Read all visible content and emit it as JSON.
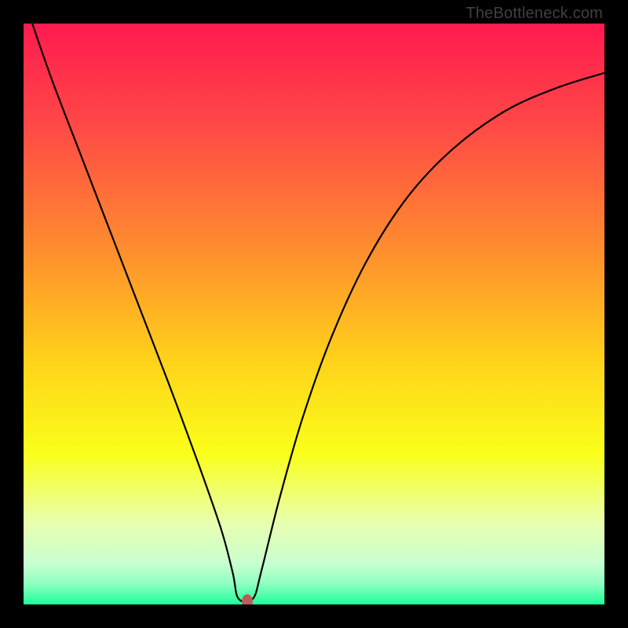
{
  "watermark": "TheBottleneck.com",
  "colors": {
    "frame": "#000000",
    "curve": "#000000",
    "marker": "#bb5d5d",
    "gradient_stops": [
      {
        "pos": 0.0,
        "color": "#ff1a4f"
      },
      {
        "pos": 0.18,
        "color": "#ff4a46"
      },
      {
        "pos": 0.38,
        "color": "#ff8a2f"
      },
      {
        "pos": 0.58,
        "color": "#ffd21a"
      },
      {
        "pos": 0.74,
        "color": "#faff1a"
      },
      {
        "pos": 0.86,
        "color": "#e8ffb0"
      },
      {
        "pos": 0.93,
        "color": "#c8ffd0"
      },
      {
        "pos": 0.965,
        "color": "#8cffc0"
      },
      {
        "pos": 1.0,
        "color": "#1dff9a"
      }
    ]
  },
  "chart_data": {
    "type": "line",
    "title": "",
    "xlabel": "",
    "ylabel": "",
    "xlim": [
      0,
      1
    ],
    "ylim": [
      0,
      1
    ],
    "annotations": [
      "TheBottleneck.com"
    ],
    "marker": {
      "x": 0.385,
      "y": 0.0
    },
    "series": [
      {
        "name": "bottleneck-curve",
        "points": [
          {
            "x": 0.015,
            "y": 1.0
          },
          {
            "x": 0.05,
            "y": 0.9
          },
          {
            "x": 0.1,
            "y": 0.77
          },
          {
            "x": 0.15,
            "y": 0.64
          },
          {
            "x": 0.2,
            "y": 0.51
          },
          {
            "x": 0.25,
            "y": 0.38
          },
          {
            "x": 0.3,
            "y": 0.245
          },
          {
            "x": 0.34,
            "y": 0.13
          },
          {
            "x": 0.36,
            "y": 0.055
          },
          {
            "x": 0.37,
            "y": 0.01
          },
          {
            "x": 0.395,
            "y": 0.01
          },
          {
            "x": 0.41,
            "y": 0.06
          },
          {
            "x": 0.44,
            "y": 0.18
          },
          {
            "x": 0.48,
            "y": 0.32
          },
          {
            "x": 0.53,
            "y": 0.46
          },
          {
            "x": 0.59,
            "y": 0.59
          },
          {
            "x": 0.66,
            "y": 0.7
          },
          {
            "x": 0.74,
            "y": 0.785
          },
          {
            "x": 0.83,
            "y": 0.85
          },
          {
            "x": 0.92,
            "y": 0.89
          },
          {
            "x": 1.0,
            "y": 0.915
          }
        ]
      }
    ]
  }
}
